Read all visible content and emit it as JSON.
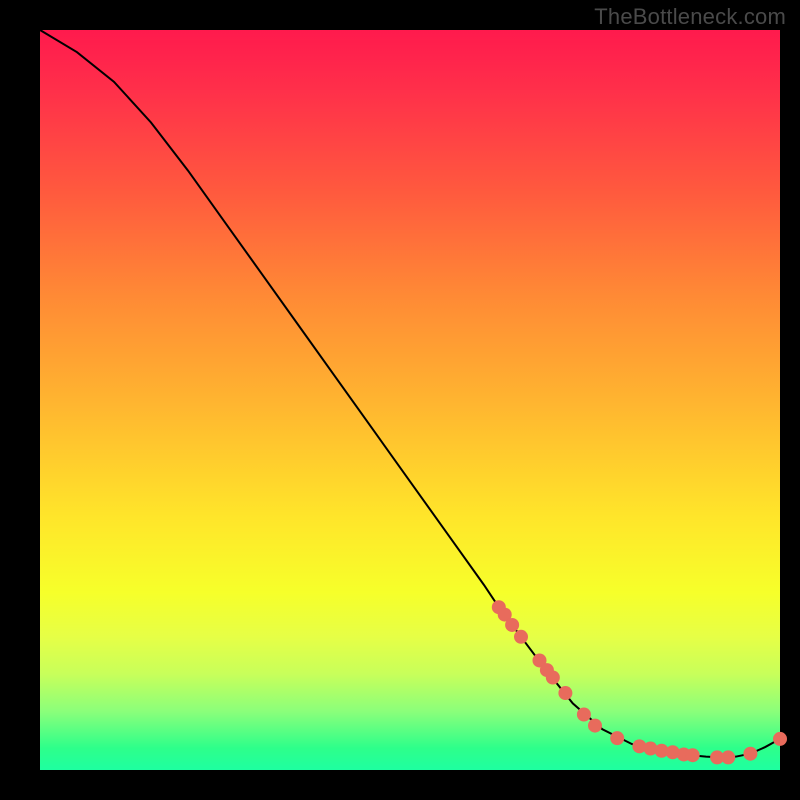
{
  "watermark": "TheBottleneck.com",
  "chart_data": {
    "type": "line",
    "title": "",
    "xlabel": "",
    "ylabel": "",
    "xlim": [
      0,
      100
    ],
    "ylim": [
      0,
      100
    ],
    "series": [
      {
        "name": "curve",
        "x": [
          0,
          5,
          10,
          15,
          20,
          25,
          30,
          35,
          40,
          45,
          50,
          55,
          60,
          62,
          65,
          68,
          72,
          76,
          80,
          83,
          86,
          88,
          90,
          92,
          94,
          96,
          98,
          100
        ],
        "y": [
          100,
          97,
          93,
          87.5,
          81,
          74,
          67,
          60,
          53,
          46,
          39,
          32,
          25,
          22,
          18,
          14,
          9,
          5.5,
          3.5,
          2.8,
          2.3,
          2.0,
          1.8,
          1.7,
          1.8,
          2.2,
          3.1,
          4.2
        ]
      }
    ],
    "markers": [
      {
        "x": 62.0,
        "y": 22.0
      },
      {
        "x": 62.8,
        "y": 21.0
      },
      {
        "x": 63.8,
        "y": 19.6
      },
      {
        "x": 65.0,
        "y": 18.0
      },
      {
        "x": 67.5,
        "y": 14.8
      },
      {
        "x": 68.5,
        "y": 13.5
      },
      {
        "x": 69.3,
        "y": 12.5
      },
      {
        "x": 71.0,
        "y": 10.4
      },
      {
        "x": 73.5,
        "y": 7.5
      },
      {
        "x": 75.0,
        "y": 6.0
      },
      {
        "x": 78.0,
        "y": 4.3
      },
      {
        "x": 81.0,
        "y": 3.2
      },
      {
        "x": 82.5,
        "y": 2.9
      },
      {
        "x": 84.0,
        "y": 2.6
      },
      {
        "x": 85.5,
        "y": 2.4
      },
      {
        "x": 87.0,
        "y": 2.1
      },
      {
        "x": 88.2,
        "y": 2.0
      },
      {
        "x": 91.5,
        "y": 1.7
      },
      {
        "x": 93.0,
        "y": 1.7
      },
      {
        "x": 96.0,
        "y": 2.2
      },
      {
        "x": 100.0,
        "y": 4.2
      }
    ]
  }
}
